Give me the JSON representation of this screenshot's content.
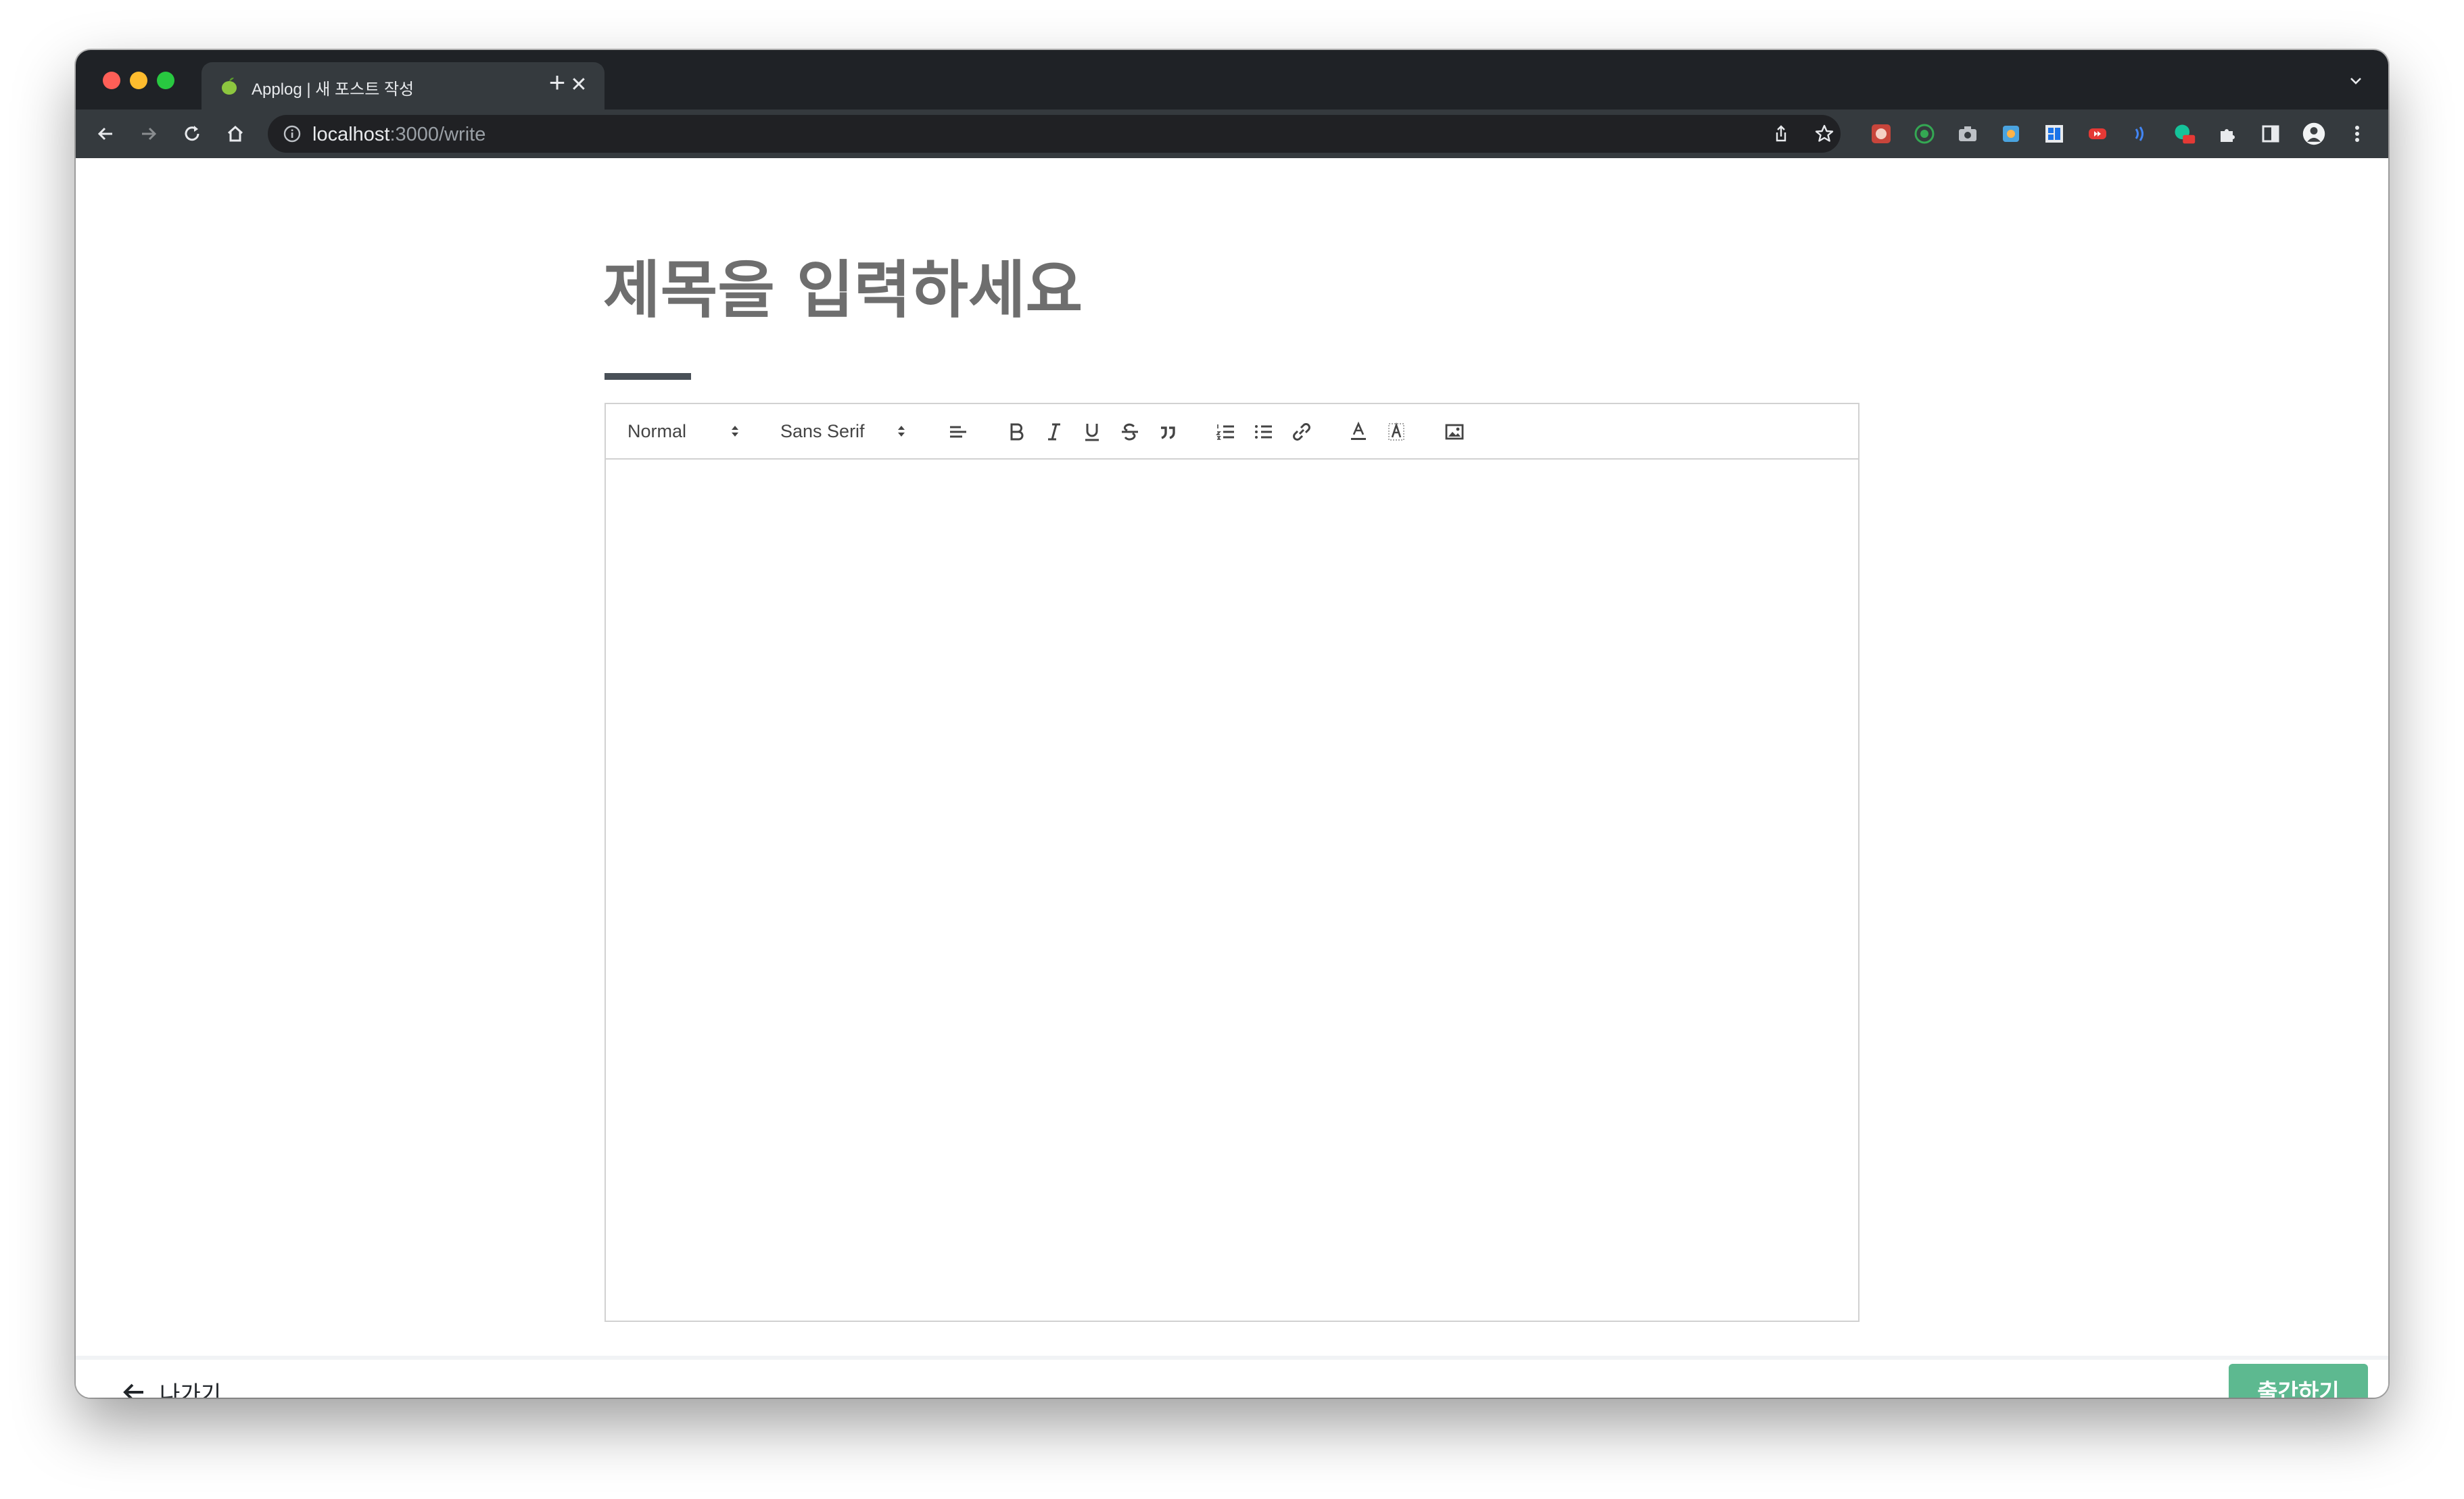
{
  "browser": {
    "tab": {
      "favicon": "apple-icon",
      "title": "Applog | 새 포스트 작성",
      "close_glyph": "✕"
    },
    "new_tab_glyph": "+",
    "tabs_menu_glyph": "⌄",
    "omnibox": {
      "host": "localhost",
      "path": ":3000/write"
    }
  },
  "editor": {
    "title_placeholder": "제목을 입력하세요",
    "toolbar": {
      "header_picker": "Normal",
      "font_picker": "Sans Serif"
    }
  },
  "footer": {
    "exit_label": "나가기",
    "publish_label": "출간하기"
  },
  "colors": {
    "accent_publish": "#5db990",
    "title_text": "#6e6e6e",
    "underline": "#495057"
  }
}
